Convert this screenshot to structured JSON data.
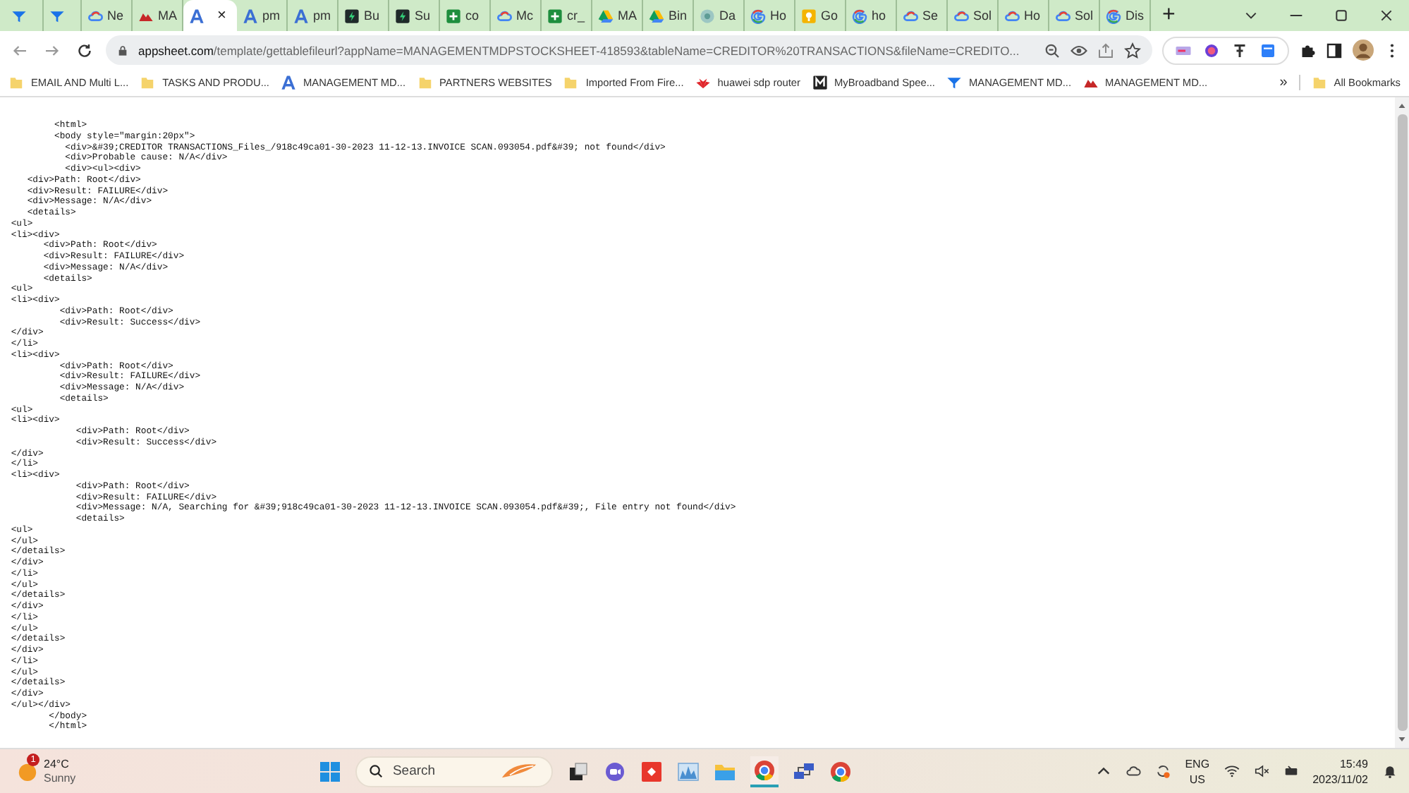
{
  "tabs": [
    {
      "kind": "funnel",
      "selected": false
    },
    {
      "kind": "funnel",
      "selected": false
    },
    {
      "kind": "cloud",
      "title": "Ne",
      "selected": false
    },
    {
      "kind": "mountain",
      "title": "MA",
      "selected": false
    },
    {
      "kind": "alogo",
      "close": "×",
      "selected": true
    },
    {
      "kind": "alogo",
      "title": "pm",
      "selected": false
    },
    {
      "kind": "alogo",
      "title": "pm",
      "selected": false
    },
    {
      "kind": "bolt",
      "title": "Bu",
      "selected": false
    },
    {
      "kind": "bolt",
      "title": "Su",
      "selected": false
    },
    {
      "kind": "sheet",
      "title": "co",
      "selected": false
    },
    {
      "kind": "cloud",
      "title": "Mc",
      "selected": false
    },
    {
      "kind": "sheet",
      "title": "cr_",
      "selected": false
    },
    {
      "kind": "drive",
      "title": "MA",
      "selected": false
    },
    {
      "kind": "drive",
      "title": "Bin",
      "selected": false
    },
    {
      "kind": "disc",
      "title": "Da",
      "selected": false
    },
    {
      "kind": "g",
      "title": "Ho",
      "selected": false
    },
    {
      "kind": "bulb",
      "title": "Go",
      "selected": false
    },
    {
      "kind": "g",
      "title": "ho",
      "selected": false
    },
    {
      "kind": "cloud",
      "title": "Se",
      "selected": false
    },
    {
      "kind": "cloud",
      "title": "Sol",
      "selected": false
    },
    {
      "kind": "cloud",
      "title": "Ho",
      "selected": false
    },
    {
      "kind": "cloud",
      "title": "Sol",
      "selected": false
    },
    {
      "kind": "g",
      "title": "Dis",
      "selected": false
    }
  ],
  "new_tab": "+",
  "address": {
    "host": "appsheet.com",
    "path": "/template/gettablefileurl?appName=MANAGEMENTMDPSTOCKSHEET-418593&tableName=CREDITOR%20TRANSACTIONS&fileName=CREDITO..."
  },
  "bookmarks": [
    {
      "kind": "folder",
      "label": "EMAIL AND Multi L..."
    },
    {
      "kind": "folder",
      "label": "TASKS AND PRODU..."
    },
    {
      "kind": "alogo",
      "label": "MANAGEMENT MD..."
    },
    {
      "kind": "folder",
      "label": "PARTNERS WEBSITES"
    },
    {
      "kind": "folder",
      "label": "Imported From Fire..."
    },
    {
      "kind": "flower",
      "label": "huawei sdp router"
    },
    {
      "kind": "mlogo",
      "label": "MyBroadband Spee..."
    },
    {
      "kind": "funnel",
      "label": "MANAGEMENT MD..."
    },
    {
      "kind": "mountain",
      "label": "MANAGEMENT MD..."
    }
  ],
  "bookmarks_more": "»",
  "all_bookmarks": "All Bookmarks",
  "code_lines": [
    "         <html>",
    "         <body style=\"margin:20px\">",
    "           <div>&#39;CREDITOR TRANSACTIONS_Files_/918c49ca01-30-2023 11-12-13.INVOICE SCAN.093054.pdf&#39; not found</div>",
    "           <div>Probable cause: N/A</div>",
    "           <div><ul><div>",
    "    <div>Path: Root</div>",
    "    <div>Result: FAILURE</div>",
    "    <div>Message: N/A</div>",
    "    <details>",
    " <ul>",
    " <li><div>",
    "       <div>Path: Root</div>",
    "       <div>Result: FAILURE</div>",
    "       <div>Message: N/A</div>",
    "       <details>",
    " <ul>",
    " <li><div>",
    "          <div>Path: Root</div>",
    "          <div>Result: Success</div>",
    " </div>",
    " </li>",
    " <li><div>",
    "          <div>Path: Root</div>",
    "          <div>Result: FAILURE</div>",
    "          <div>Message: N/A</div>",
    "          <details>",
    " <ul>",
    " <li><div>",
    "             <div>Path: Root</div>",
    "             <div>Result: Success</div>",
    " </div>",
    " </li>",
    " <li><div>",
    "             <div>Path: Root</div>",
    "             <div>Result: FAILURE</div>",
    "             <div>Message: N/A, Searching for &#39;918c49ca01-30-2023 11-12-13.INVOICE SCAN.093054.pdf&#39;, File entry not found</div>",
    "             <details>",
    " <ul>",
    " </ul>",
    " </details>",
    " </div>",
    " </li>",
    " </ul>",
    " </details>",
    " </div>",
    " </li>",
    " </ul>",
    " </details>",
    " </div>",
    " </li>",
    " </ul>",
    " </details>",
    " </div>",
    " </ul></div>",
    "        </body>",
    "        </html>"
  ],
  "taskbar": {
    "weather": {
      "temp": "24°C",
      "condition": "Sunny",
      "badge": "1"
    },
    "search_placeholder": "Search",
    "language": "ENG",
    "region": "US",
    "time": "15:49",
    "date": "2023/11/02"
  }
}
